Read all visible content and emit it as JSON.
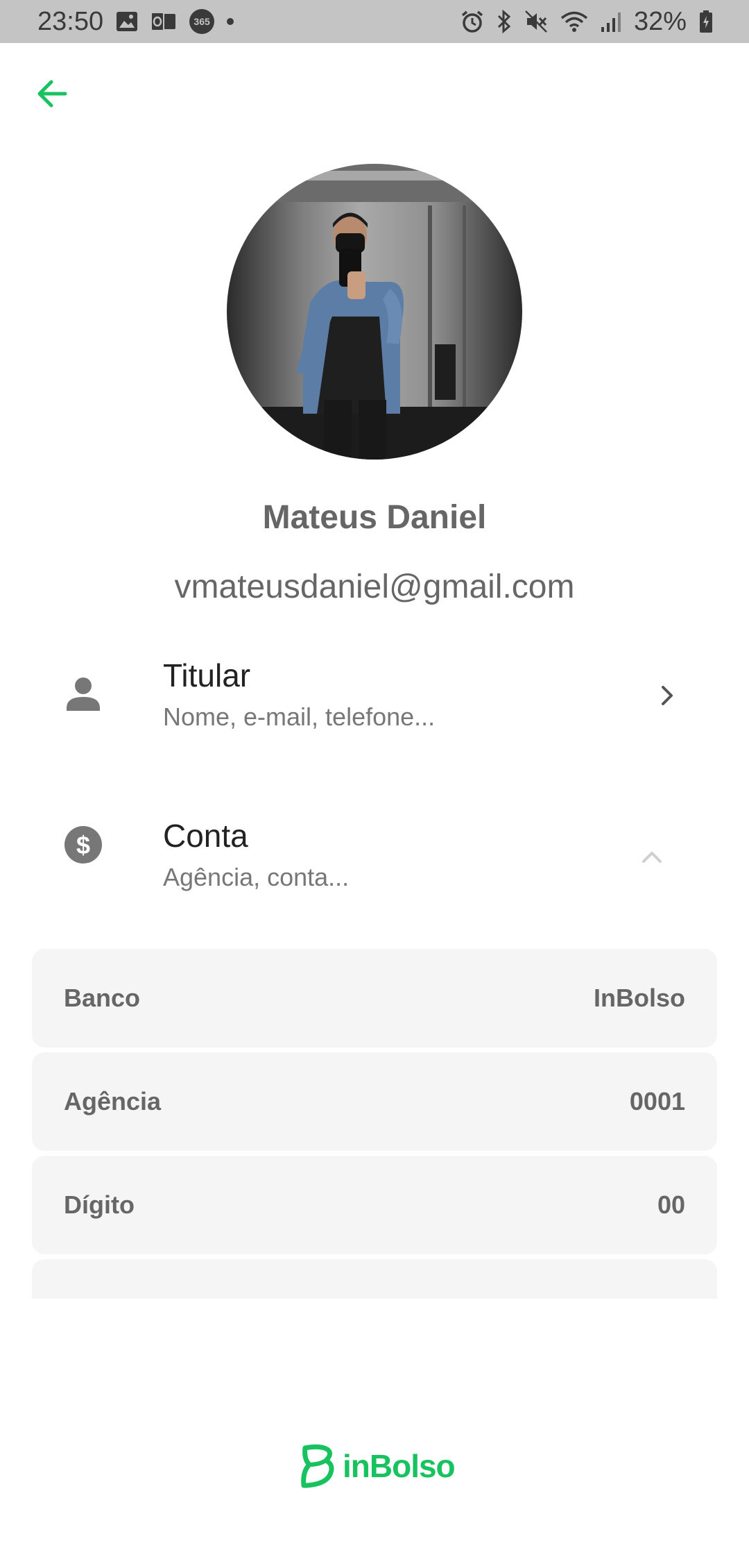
{
  "status_bar": {
    "time": "23:50",
    "battery": "32%",
    "left_icons": [
      "gallery-icon",
      "outlook-icon",
      "office365-icon",
      "dot-icon"
    ],
    "right_icons": [
      "alarm-icon",
      "bluetooth-icon",
      "mute-icon",
      "wifi-icon",
      "signal-icon",
      "battery-icon"
    ],
    "office_label": "365"
  },
  "header": {
    "back_icon": "arrow-left-icon"
  },
  "profile": {
    "name": "Mateus Daniel",
    "email": "vmateusdaniel@gmail.com"
  },
  "sections": {
    "titular": {
      "title": "Titular",
      "subtitle": "Nome, e-mail, telefone...",
      "icon": "person-icon",
      "chevron": "chevron-right-icon"
    },
    "conta": {
      "title": "Conta",
      "subtitle": "Agência, conta...",
      "icon": "dollar-icon",
      "chevron": "chevron-up-icon"
    }
  },
  "account_rows": [
    {
      "label": "Banco",
      "value": "InBolso"
    },
    {
      "label": "Agência",
      "value": "0001"
    },
    {
      "label": "Dígito",
      "value": "00"
    },
    {
      "label": "",
      "value": ""
    }
  ],
  "footer": {
    "logo_text": "inBolso"
  },
  "colors": {
    "accent": "#18c25f",
    "status_bar": "#c4c4c4",
    "row_bg": "#f5f5f5",
    "text_gray": "#666666"
  }
}
